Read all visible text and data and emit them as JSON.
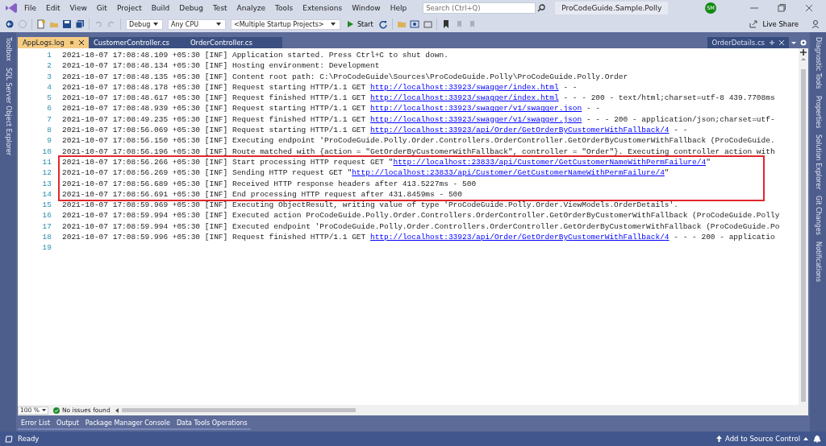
{
  "menu_bar": {
    "items": [
      "File",
      "Edit",
      "View",
      "Git",
      "Project",
      "Build",
      "Debug",
      "Test",
      "Analyze",
      "Tools",
      "Extensions",
      "Window",
      "Help"
    ],
    "search": {
      "placeholder": "Search (Ctrl+Q)"
    },
    "solution_name": "ProCodeGuide.Sample.Polly",
    "avatar": "SM"
  },
  "toolbar": {
    "configuration": "Debug",
    "platform": "Any CPU",
    "startup": "<Multiple Startup Projects>",
    "start": "Start",
    "live_share": "Live Share"
  },
  "left_dock": [
    "Toolbox",
    "SQL Server Object Explorer"
  ],
  "tabs": [
    {
      "label": "AppLogs.log",
      "selected": true
    },
    {
      "label": "CustomerController.cs",
      "selected": false
    },
    {
      "label": "OrderController.cs",
      "selected": false
    }
  ],
  "preview_tab": "OrderDetails.cs",
  "editor": {
    "lines": [
      {
        "number": "1",
        "boxed": false,
        "parts": [
          {
            "kind": "text",
            "text": "2021-10-07 17:08:48.109 +05:30 [INF] Application started. Press Ctrl+C to shut down."
          }
        ]
      },
      {
        "number": "2",
        "boxed": false,
        "parts": [
          {
            "kind": "text",
            "text": "2021-10-07 17:08:48.134 +05:30 [INF] Hosting environment: Development"
          }
        ]
      },
      {
        "number": "3",
        "boxed": false,
        "parts": [
          {
            "kind": "text",
            "text": "2021-10-07 17:08:48.135 +05:30 [INF] Content root path: C:\\ProCodeGuide\\Sources\\ProCodeGuide.Polly\\ProCodeGuide.Polly.Order"
          }
        ]
      },
      {
        "number": "4",
        "boxed": false,
        "parts": [
          {
            "kind": "text",
            "text": "2021-10-07 17:08:48.178 +05:30 [INF] Request starting HTTP/1.1 GET "
          },
          {
            "kind": "link",
            "text": "http://localhost:33923/swagger/index.html"
          },
          {
            "kind": "text",
            "text": " - -"
          }
        ]
      },
      {
        "number": "5",
        "boxed": false,
        "parts": [
          {
            "kind": "text",
            "text": "2021-10-07 17:08:48.617 +05:30 [INF] Request finished HTTP/1.1 GET "
          },
          {
            "kind": "link",
            "text": "http://localhost:33923/swagger/index.html"
          },
          {
            "kind": "text",
            "text": " - - - 200 - text/html;charset=utf-8 439.7708ms"
          }
        ]
      },
      {
        "number": "6",
        "boxed": false,
        "parts": [
          {
            "kind": "text",
            "text": "2021-10-07 17:08:48.939 +05:30 [INF] Request starting HTTP/1.1 GET "
          },
          {
            "kind": "link",
            "text": "http://localhost:33923/swagger/v1/swagger.json"
          },
          {
            "kind": "text",
            "text": " - -"
          }
        ]
      },
      {
        "number": "7",
        "boxed": false,
        "parts": [
          {
            "kind": "text",
            "text": "2021-10-07 17:08:49.235 +05:30 [INF] Request finished HTTP/1.1 GET "
          },
          {
            "kind": "link",
            "text": "http://localhost:33923/swagger/v1/swagger.json"
          },
          {
            "kind": "text",
            "text": " - - - 200 - application/json;charset=utf-"
          }
        ]
      },
      {
        "number": "8",
        "boxed": false,
        "parts": [
          {
            "kind": "text",
            "text": "2021-10-07 17:08:56.069 +05:30 [INF] Request starting HTTP/1.1 GET "
          },
          {
            "kind": "link",
            "text": "http://localhost:33923/api/Order/GetOrderByCustomerWithFallback/4"
          },
          {
            "kind": "text",
            "text": " - -"
          }
        ]
      },
      {
        "number": "9",
        "boxed": false,
        "parts": [
          {
            "kind": "text",
            "text": "2021-10-07 17:08:56.150 +05:30 [INF] Executing endpoint 'ProCodeGuide.Polly.Order.Controllers.OrderController.GetOrderByCustomerWithFallback (ProCodeGuide."
          }
        ]
      },
      {
        "number": "10",
        "boxed": false,
        "parts": [
          {
            "kind": "text",
            "text": "2021-10-07 17:08:56.196 +05:30 [INF] Route matched with {action = \"GetOrderByCustomerWithFallback\", controller = \"Order\"}. Executing controller action with"
          }
        ]
      },
      {
        "number": "11",
        "boxed": true,
        "parts": [
          {
            "kind": "text",
            "text": "2021-10-07 17:08:56.266 +05:30 [INF] Start processing HTTP request GET \""
          },
          {
            "kind": "link",
            "text": "http://localhost:23833/api/Customer/GetCustomerNameWithPermFailure/4"
          },
          {
            "kind": "text",
            "text": "\""
          }
        ]
      },
      {
        "number": "12",
        "boxed": true,
        "parts": [
          {
            "kind": "text",
            "text": "2021-10-07 17:08:56.269 +05:30 [INF] Sending HTTP request GET \""
          },
          {
            "kind": "link",
            "text": "http://localhost:23833/api/Customer/GetCustomerNameWithPermFailure/4"
          },
          {
            "kind": "text",
            "text": "\""
          }
        ]
      },
      {
        "number": "13",
        "boxed": true,
        "parts": [
          {
            "kind": "text",
            "text": "2021-10-07 17:08:56.689 +05:30 [INF] Received HTTP response headers after 413.5227ms - 500"
          }
        ]
      },
      {
        "number": "14",
        "boxed": true,
        "parts": [
          {
            "kind": "text",
            "text": "2021-10-07 17:08:56.691 +05:30 [INF] End processing HTTP request after 431.8459ms - 500"
          }
        ]
      },
      {
        "number": "15",
        "boxed": false,
        "parts": [
          {
            "kind": "text",
            "text": "2021-10-07 17:08:59.969 +05:30 [INF] Executing ObjectResult, writing value of type 'ProCodeGuide.Polly.Order.ViewModels.OrderDetails'."
          }
        ]
      },
      {
        "number": "16",
        "boxed": false,
        "parts": [
          {
            "kind": "text",
            "text": "2021-10-07 17:08:59.994 +05:30 [INF] Executed action ProCodeGuide.Polly.Order.Controllers.OrderController.GetOrderByCustomerWithFallback (ProCodeGuide.Polly"
          }
        ]
      },
      {
        "number": "17",
        "boxed": false,
        "parts": [
          {
            "kind": "text",
            "text": "2021-10-07 17:08:59.994 +05:30 [INF] Executed endpoint 'ProCodeGuide.Polly.Order.Controllers.OrderController.GetOrderByCustomerWithFallback (ProCodeGuide.Po"
          }
        ]
      },
      {
        "number": "18",
        "boxed": false,
        "parts": [
          {
            "kind": "text",
            "text": "2021-10-07 17:08:59.996 +05:30 [INF] Request finished HTTP/1.1 GET "
          },
          {
            "kind": "link",
            "text": "http://localhost:33923/api/Order/GetOrderByCustomerWithFallback/4"
          },
          {
            "kind": "text",
            "text": " - - - 200 - applicatio"
          }
        ]
      },
      {
        "number": "19",
        "boxed": false
      }
    ]
  },
  "editor_footer": {
    "zoom": "100 %",
    "issues": "No issues found"
  },
  "right_dock": [
    "Diagnostic Tools",
    "Properties",
    "Solution Explorer",
    "Git Changes",
    "Notifications"
  ],
  "tool_tabs": [
    "Error List",
    "Output",
    "Package Manager Console",
    "Data Tools Operations"
  ],
  "status_bar": {
    "text": "Ready",
    "source_control": "Add to Source Control"
  }
}
